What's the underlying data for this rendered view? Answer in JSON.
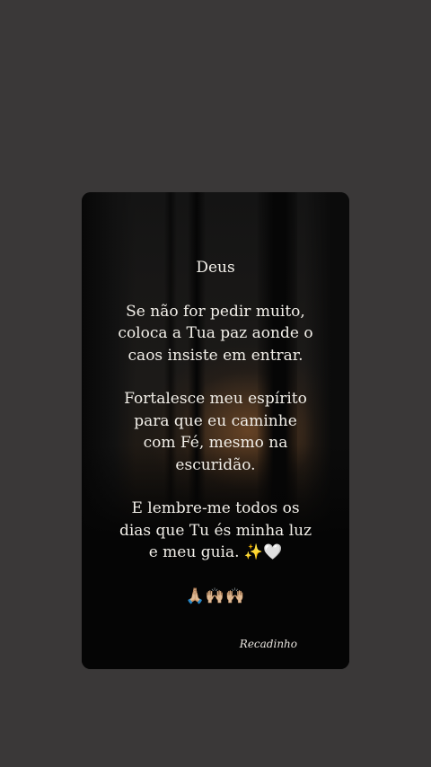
{
  "card": {
    "title": "Deus",
    "paragraphs": [
      "Se não for pedir muito,\ncoloca a Tua paz aonde o\ncaos insiste em entrar.",
      "Fortalesce meu espírito\npara que eu caminhe\ncom Fé, mesmo na\nescuridão.",
      "E lembre-me todos os\ndias que Tu és minha luz\ne meu guia. ✨🤍"
    ],
    "emojis": "🙏🏼🙌🏼🙌🏼",
    "signature": "Recadinho"
  },
  "colors": {
    "page_background": "#3a3838",
    "text": "#f2efe9"
  }
}
